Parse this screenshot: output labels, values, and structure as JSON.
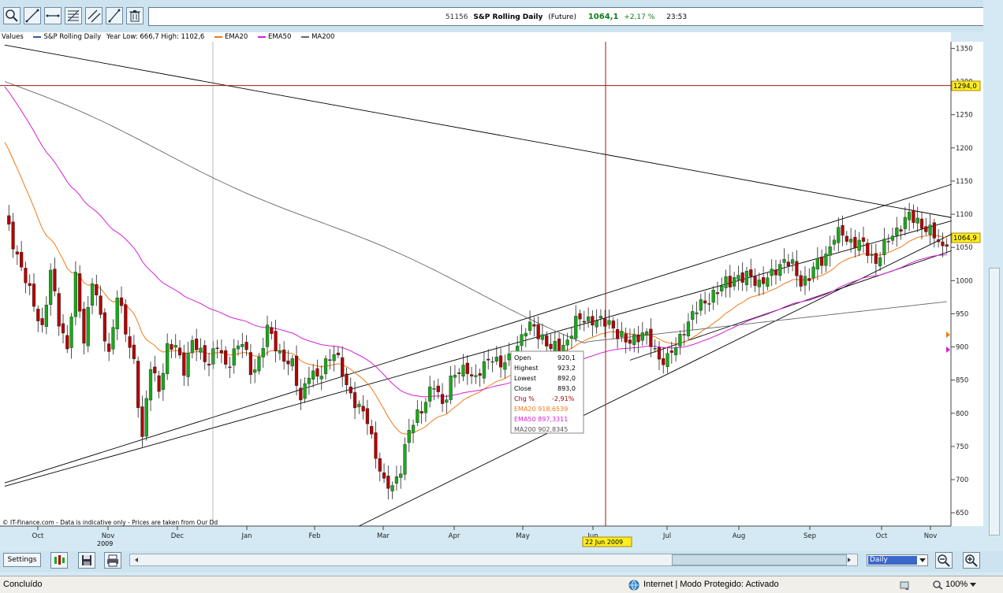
{
  "header": {
    "symbol_code": "51156",
    "instrument": "S&P Rolling Daily",
    "type": "(Future)",
    "price": "1064,1",
    "change": "+2,17 %",
    "time": "23:53"
  },
  "legend": {
    "values_label": "Values",
    "series_label": "S&P Rolling Daily",
    "year_range": "Year Low: 666,7 High: 1102,6",
    "ema20": "EMA20",
    "ema50": "EMA50",
    "ma200": "MA200"
  },
  "colors": {
    "up": "#1aa81a",
    "down": "#b30000",
    "ema20": "#f07a1a",
    "ema50": "#d61fd6",
    "ma200": "#666666",
    "trend": "#000000",
    "level": "#aa1111",
    "tag": "#ffee22"
  },
  "chart_data": {
    "type": "candlestick",
    "ylim": [
      630,
      1360
    ],
    "y_ticks": [
      650,
      700,
      750,
      800,
      850,
      900,
      950,
      1000,
      1050,
      1100,
      1150,
      1200,
      1250,
      1300,
      1350
    ],
    "x_labels": [
      "Oct",
      "Nov",
      "Dec",
      "Jan",
      "Feb",
      "Mar",
      "Apr",
      "May",
      "Jun",
      "Jul",
      "Aug",
      "Sep",
      "Oct",
      "Nov"
    ],
    "year_label": "2009",
    "crosshair_date": "22 Jun 2009",
    "crosshair_level": "1294,0",
    "last_price_tag": "1064,9",
    "footer_note": "© IT-Finance.com - Data is indicative only - Prices are taken from Our Dd",
    "trend_lines": "descending resistance from 1350 area; ascending support channel lines",
    "anchors": [
      {
        "d": 0,
        "p": 1095
      },
      {
        "d": 3,
        "p": 1040
      },
      {
        "d": 6,
        "p": 980
      },
      {
        "d": 9,
        "p": 930
      },
      {
        "d": 11,
        "p": 1010
      },
      {
        "d": 13,
        "p": 940
      },
      {
        "d": 15,
        "p": 900
      },
      {
        "d": 17,
        "p": 1000
      },
      {
        "d": 19,
        "p": 910
      },
      {
        "d": 21,
        "p": 1005
      },
      {
        "d": 23,
        "p": 940
      },
      {
        "d": 25,
        "p": 890
      },
      {
        "d": 27,
        "p": 980
      },
      {
        "d": 29,
        "p": 920
      },
      {
        "d": 31,
        "p": 880
      },
      {
        "d": 33,
        "p": 760
      },
      {
        "d": 35,
        "p": 870
      },
      {
        "d": 37,
        "p": 840
      },
      {
        "d": 39,
        "p": 895
      },
      {
        "d": 41,
        "p": 900
      },
      {
        "d": 43,
        "p": 870
      },
      {
        "d": 45,
        "p": 905
      },
      {
        "d": 47,
        "p": 890
      },
      {
        "d": 49,
        "p": 880
      },
      {
        "d": 51,
        "p": 900
      },
      {
        "d": 53,
        "p": 870
      },
      {
        "d": 55,
        "p": 895
      },
      {
        "d": 57,
        "p": 905
      },
      {
        "d": 59,
        "p": 865
      },
      {
        "d": 61,
        "p": 880
      },
      {
        "d": 63,
        "p": 925
      },
      {
        "d": 65,
        "p": 905
      },
      {
        "d": 67,
        "p": 880
      },
      {
        "d": 69,
        "p": 870
      },
      {
        "d": 71,
        "p": 825
      },
      {
        "d": 73,
        "p": 860
      },
      {
        "d": 75,
        "p": 850
      },
      {
        "d": 77,
        "p": 880
      },
      {
        "d": 79,
        "p": 890
      },
      {
        "d": 81,
        "p": 860
      },
      {
        "d": 83,
        "p": 830
      },
      {
        "d": 85,
        "p": 805
      },
      {
        "d": 87,
        "p": 790
      },
      {
        "d": 89,
        "p": 740
      },
      {
        "d": 91,
        "p": 690
      },
      {
        "d": 93,
        "p": 690
      },
      {
        "d": 95,
        "p": 720
      },
      {
        "d": 97,
        "p": 770
      },
      {
        "d": 99,
        "p": 800
      },
      {
        "d": 101,
        "p": 820
      },
      {
        "d": 103,
        "p": 840
      },
      {
        "d": 105,
        "p": 815
      },
      {
        "d": 107,
        "p": 850
      },
      {
        "d": 109,
        "p": 860
      },
      {
        "d": 111,
        "p": 870
      },
      {
        "d": 113,
        "p": 850
      },
      {
        "d": 115,
        "p": 870
      },
      {
        "d": 117,
        "p": 890
      },
      {
        "d": 119,
        "p": 870
      },
      {
        "d": 121,
        "p": 880
      },
      {
        "d": 123,
        "p": 905
      },
      {
        "d": 125,
        "p": 925
      },
      {
        "d": 127,
        "p": 930
      },
      {
        "d": 129,
        "p": 915
      },
      {
        "d": 131,
        "p": 895
      },
      {
        "d": 133,
        "p": 900
      },
      {
        "d": 135,
        "p": 910
      },
      {
        "d": 137,
        "p": 935
      },
      {
        "d": 139,
        "p": 945
      },
      {
        "d": 141,
        "p": 940
      },
      {
        "d": 143,
        "p": 935
      },
      {
        "d": 145,
        "p": 940
      },
      {
        "d": 147,
        "p": 920
      },
      {
        "d": 149,
        "p": 905
      },
      {
        "d": 151,
        "p": 915
      },
      {
        "d": 153,
        "p": 920
      },
      {
        "d": 155,
        "p": 905
      },
      {
        "d": 157,
        "p": 885
      },
      {
        "d": 159,
        "p": 880
      },
      {
        "d": 161,
        "p": 900
      },
      {
        "d": 163,
        "p": 930
      },
      {
        "d": 165,
        "p": 945
      },
      {
        "d": 167,
        "p": 965
      },
      {
        "d": 169,
        "p": 975
      },
      {
        "d": 171,
        "p": 980
      },
      {
        "d": 173,
        "p": 1000
      },
      {
        "d": 175,
        "p": 1005
      },
      {
        "d": 177,
        "p": 1000
      },
      {
        "d": 179,
        "p": 1010
      },
      {
        "d": 181,
        "p": 995
      },
      {
        "d": 183,
        "p": 1000
      },
      {
        "d": 185,
        "p": 1020
      },
      {
        "d": 187,
        "p": 1030
      },
      {
        "d": 189,
        "p": 1020
      },
      {
        "d": 191,
        "p": 1000
      },
      {
        "d": 193,
        "p": 1005
      },
      {
        "d": 195,
        "p": 1025
      },
      {
        "d": 197,
        "p": 1040
      },
      {
        "d": 199,
        "p": 1065
      },
      {
        "d": 201,
        "p": 1070
      },
      {
        "d": 203,
        "p": 1060
      },
      {
        "d": 205,
        "p": 1055
      },
      {
        "d": 207,
        "p": 1045
      },
      {
        "d": 209,
        "p": 1030
      },
      {
        "d": 211,
        "p": 1050
      },
      {
        "d": 213,
        "p": 1070
      },
      {
        "d": 215,
        "p": 1085
      },
      {
        "d": 217,
        "p": 1095
      },
      {
        "d": 219,
        "p": 1090
      },
      {
        "d": 221,
        "p": 1080
      },
      {
        "d": 223,
        "p": 1065
      },
      {
        "d": 225,
        "p": 1050
      },
      {
        "d": 226,
        "p": 1064
      }
    ]
  },
  "info_box": {
    "open_label": "Open",
    "open_value": "920,1",
    "high_label": "Highest",
    "high_value": "923,2",
    "low_label": "Lowest",
    "low_value": "892,0",
    "close_label": "Close",
    "close_value": "893,0",
    "chg_label": "Chg %",
    "chg_value": "-2,91%",
    "ema20_text": "EMA20 918,6539",
    "ema50_text": "EMA50 897,3311",
    "ma200_text": "MA200 902,8345"
  },
  "controls": {
    "settings_label": "Settings",
    "period_value": "Daily"
  },
  "statusbar": {
    "left": "Concluído",
    "zone": "Internet | Modo Protegido: Activado",
    "zoom": "100%"
  }
}
